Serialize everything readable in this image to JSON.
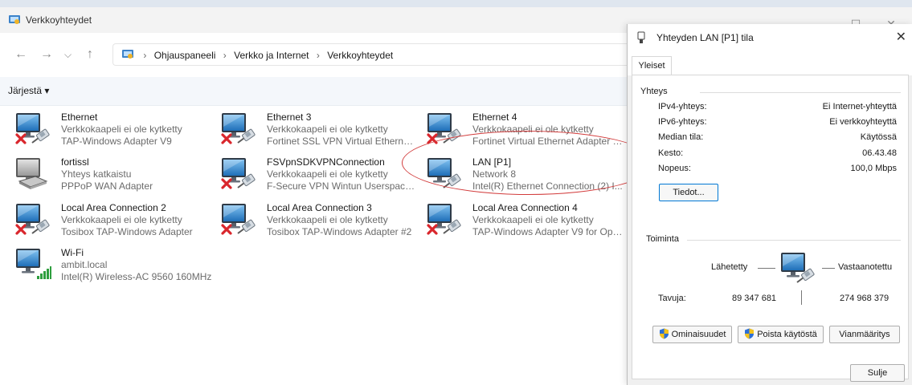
{
  "window": {
    "title": "Verkkoyhteydet",
    "min_glyph": "—",
    "max_glyph": "☐",
    "close_glyph": "✕"
  },
  "nav": {
    "back_glyph": "←",
    "forward_glyph": "→",
    "dropdown_glyph": "⌵",
    "up_glyph": "↑",
    "crumbs": [
      "Ohjauspaneeli",
      "Verkko ja Internet",
      "Verkkoyhteydet"
    ],
    "crumb_sep": "›"
  },
  "commandbar": {
    "organize_label": "Järjestä ▾"
  },
  "connections": [
    {
      "name": "Ethernet",
      "status": "Verkkokaapeli ei ole kytketty",
      "adapter": "TAP-Windows Adapter V9",
      "icon": "network-disconnected-icon"
    },
    {
      "name": "Ethernet 3",
      "status": "Verkkokaapeli ei ole kytketty",
      "adapter": "Fortinet SSL VPN Virtual Ethernet ...",
      "icon": "network-disconnected-icon"
    },
    {
      "name": "Ethernet 4",
      "status": "Verkkokaapeli ei ole kytketty",
      "adapter": "Fortinet Virtual Ethernet Adapter (...",
      "icon": "network-disconnected-icon"
    },
    {
      "name": "fortissl",
      "status": "Yhteys katkaistu",
      "adapter": "PPPoP WAN Adapter",
      "icon": "dialup-icon"
    },
    {
      "name": "FSVpnSDKVPNConnection",
      "status": "Verkkokaapeli ei ole kytketty",
      "adapter": "F-Secure VPN Wintun Userspace ...",
      "icon": "network-disconnected-icon"
    },
    {
      "name": "LAN [P1]",
      "status": "Network 8",
      "adapter": "Intel(R) Ethernet Connection (2) I...",
      "icon": "network-connected-icon"
    },
    {
      "name": "Local Area Connection 2",
      "status": "Verkkokaapeli ei ole kytketty",
      "adapter": "Tosibox TAP-Windows Adapter",
      "icon": "network-disconnected-icon"
    },
    {
      "name": "Local Area Connection 3",
      "status": "Verkkokaapeli ei ole kytketty",
      "adapter": "Tosibox TAP-Windows Adapter #2",
      "icon": "network-disconnected-icon"
    },
    {
      "name": "Local Area Connection 4",
      "status": "Verkkokaapeli ei ole kytketty",
      "adapter": "TAP-Windows Adapter V9 for Ope...",
      "icon": "network-disconnected-icon"
    },
    {
      "name": "Wi-Fi",
      "status": "ambit.local",
      "adapter": "Intel(R) Wireless-AC 9560 160MHz",
      "icon": "wifi-icon"
    }
  ],
  "dialog": {
    "title": "Yhteyden LAN [P1] tila",
    "close_glyph": "✕",
    "tab": "Yleiset",
    "connection_group": "Yhteys",
    "rows": [
      {
        "label": "IPv4-yhteys:",
        "value": "Ei Internet-yhteyttä"
      },
      {
        "label": "IPv6-yhteys:",
        "value": "Ei verkkoyhteyttä"
      },
      {
        "label": "Median tila:",
        "value": "Käytössä"
      },
      {
        "label": "Kesto:",
        "value": "06.43.48"
      },
      {
        "label": "Nopeus:",
        "value": "100,0 Mbps"
      }
    ],
    "details_button": "Tiedot...",
    "activity_group": "Toiminta",
    "sent_label": "Lähetetty",
    "received_label": "Vastaanotettu",
    "bytes_label": "Tavuja:",
    "bytes_sent": "89 347 681",
    "bytes_received": "274 968 379",
    "properties_button": "Ominaisuudet",
    "disable_button": "Poista käytöstä",
    "diagnose_button": "Vianmääritys",
    "close_button": "Sulje"
  },
  "colors": {
    "annotation": "#d23c3c",
    "monitor_blue": "#3b82c9",
    "error_red": "#d9262c",
    "wifi_green": "#2e9e3e"
  }
}
